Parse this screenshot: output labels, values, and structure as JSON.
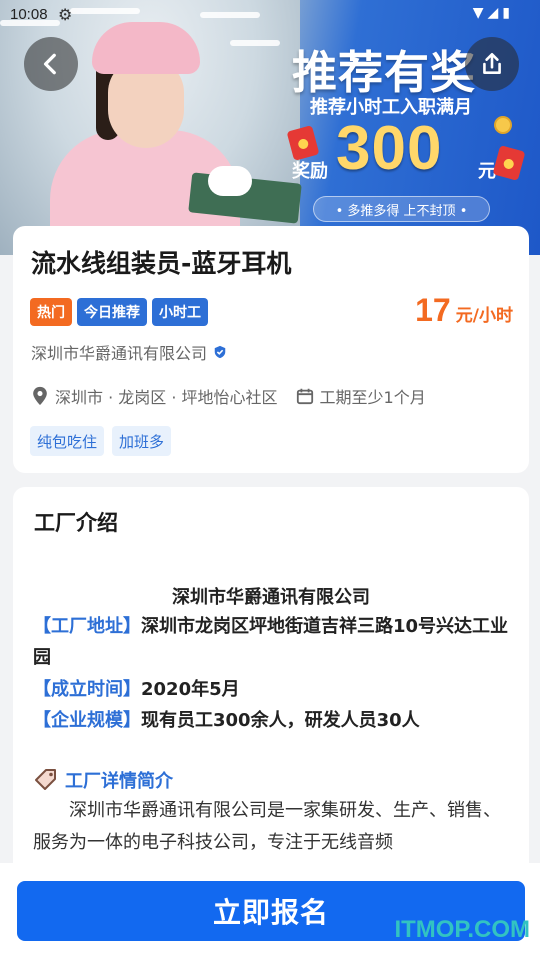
{
  "status_bar": {
    "time": "10:08",
    "settings_icon": "gear-icon",
    "right_icons": "wifi-icon signal-icon battery-icon"
  },
  "header": {
    "back_icon": "back-arrow-icon",
    "share_icon": "share-icon"
  },
  "banner": {
    "title": "推荐有奖",
    "subtitle": "推荐小时工入职满月",
    "reward_label": "奖励",
    "reward_amount": "300",
    "reward_unit": "元",
    "pill_text": "• 多推多得 上不封顶 •"
  },
  "job": {
    "title": "流水线组装员-蓝牙耳机",
    "tags": [
      {
        "label": "热门",
        "color": "#f36a21"
      },
      {
        "label": "今日推荐",
        "color": "#2d6fd6"
      },
      {
        "label": "小时工",
        "color": "#2d6fd6"
      }
    ],
    "salary_value": "17",
    "salary_unit": "元/小时",
    "company": "深圳市华爵通讯有限公司",
    "location": "深圳市 · 龙岗区 · 坪地怡心社区",
    "duration": "工期至少1个月",
    "perks": [
      "纯包吃住",
      "加班多"
    ]
  },
  "factory_intro": {
    "heading": "工厂介绍",
    "company_name": "深圳市华爵通讯有限公司",
    "address_key": "【工厂地址】",
    "address_value": "深圳市龙岗区坪地街道吉祥三路10号兴达工业园",
    "founded_key": "【成立时间】",
    "founded_value": "2020年5月",
    "scale_key": "【企业规模】",
    "scale_value": "现有员工300余人，研发人员30人",
    "detail_heading": "工厂详情简介",
    "detail_text": "深圳市华爵通讯有限公司是一家集研发、生产、销售、服务为一体的电子科技公司，专注于无线音频"
  },
  "footer": {
    "apply_label": "立即报名"
  },
  "watermark": "ITMOP.COM",
  "colors": {
    "primary": "#1269f0",
    "accent_orange": "#f36a21",
    "link_blue": "#2d6fd6"
  }
}
